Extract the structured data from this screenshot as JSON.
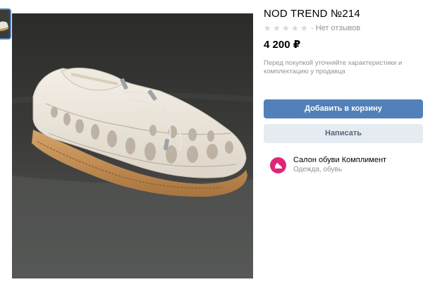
{
  "product": {
    "title": "NOD TREND №214",
    "rating_stars": 0,
    "rating_max": 5,
    "reviews_text": "· Нет отзывов",
    "price": "4 200 ₽",
    "note": "Перед покупкой уточняйте характеристики и комплектацию у продавца"
  },
  "actions": {
    "add_to_cart": "Добавить в корзину",
    "write": "Написать"
  },
  "seller": {
    "name": "Салон обуви Комплимент",
    "category": "Одежда, обувь"
  },
  "colors": {
    "accent": "#5181b8",
    "secondary_bg": "#e5ebf1",
    "seller_avatar": "#e0247a",
    "muted_text": "#939393"
  },
  "icons": {
    "star": "star-icon",
    "seller_avatar": "shoe-icon"
  }
}
